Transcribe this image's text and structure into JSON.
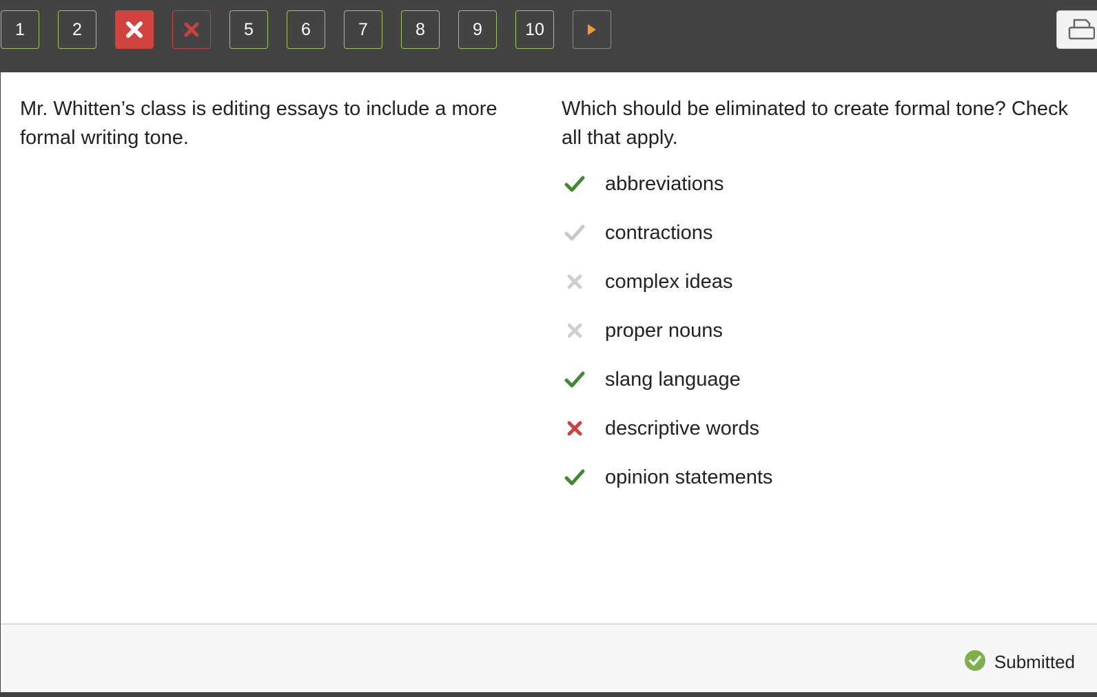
{
  "nav": {
    "questions": [
      {
        "label": "1",
        "state": "answered"
      },
      {
        "label": "2",
        "state": "answered"
      },
      {
        "label": "",
        "state": "incorrect-current",
        "icon": "x-icon"
      },
      {
        "label": "",
        "state": "incorrect",
        "icon": "x-icon"
      },
      {
        "label": "5",
        "state": "answered"
      },
      {
        "label": "6",
        "state": "answered"
      },
      {
        "label": "7",
        "state": "answered"
      },
      {
        "label": "8",
        "state": "answered"
      },
      {
        "label": "9",
        "state": "answered"
      },
      {
        "label": "10",
        "state": "answered"
      }
    ],
    "next_icon": "play-arrow-icon",
    "print_icon": "printer-icon"
  },
  "prompt": {
    "text": "Mr. Whitten’s class is editing essays to include a more formal writing tone."
  },
  "question": {
    "text": "Which should be eliminated to create formal tone? Check all that apply.",
    "options": [
      {
        "label": "abbreviations",
        "mark": "correct-selected"
      },
      {
        "label": "contractions",
        "mark": "correct-missed"
      },
      {
        "label": "complex ideas",
        "mark": "incorrect-unselected"
      },
      {
        "label": "proper nouns",
        "mark": "incorrect-unselected"
      },
      {
        "label": "slang language",
        "mark": "correct-selected"
      },
      {
        "label": "descriptive words",
        "mark": "incorrect-selected"
      },
      {
        "label": "opinion statements",
        "mark": "correct-selected"
      }
    ]
  },
  "colors": {
    "green": "#3e8a2c",
    "red": "#c9423e",
    "gray": "#c8c8c8",
    "accent_orange": "#f29a38"
  },
  "footer": {
    "status": "Submitted"
  }
}
